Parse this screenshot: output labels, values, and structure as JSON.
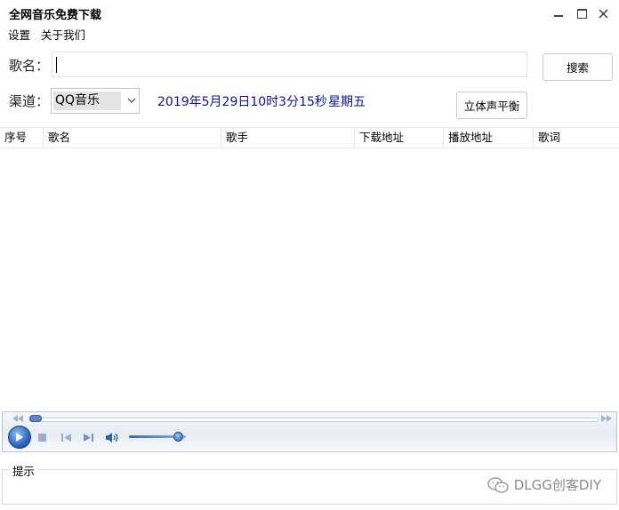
{
  "window": {
    "title": "全网音乐免费下载"
  },
  "menu": {
    "settings": "设置",
    "about": "关于我们"
  },
  "search": {
    "label": "歌名：",
    "value": "",
    "button": "搜索"
  },
  "channel": {
    "label": "渠道：",
    "selected": "QQ音乐"
  },
  "datetime": {
    "text": "2019年5月29日10时3分15秒",
    "weekday": "星期五"
  },
  "balance_button": "立体声平衡",
  "table": {
    "columns": [
      "序号",
      "歌名",
      "歌手",
      "下载地址",
      "播放地址",
      "歌词"
    ],
    "rows": []
  },
  "player": {
    "seek_progress": 0.0,
    "volume": 0.95
  },
  "hint": {
    "label": "提示"
  },
  "watermark": {
    "text": "DLGG创客DIY"
  },
  "colors": {
    "datetime": "#1010a8",
    "player_accent": "#2a66c2"
  }
}
